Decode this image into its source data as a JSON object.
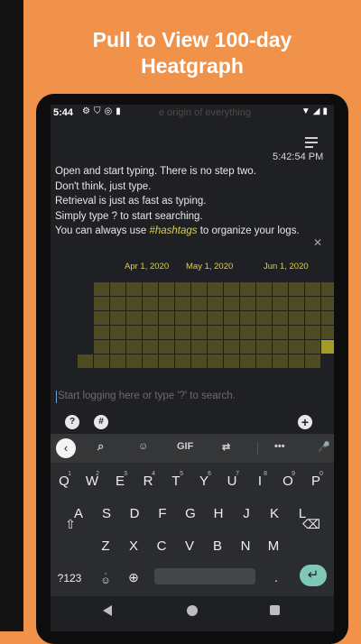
{
  "headline": {
    "line1": "Pull to View 100-day",
    "line2": "Heatgraph"
  },
  "status_bar": {
    "time": "5:44",
    "ghost_text": "e origin of everything"
  },
  "log": {
    "timestamp": "5:42:54 PM",
    "lines": [
      "Open and start typing. There is no step two.",
      "Don't think, just type.",
      "Retrieval is just as fast as typing.",
      "Simply type ? to start searching."
    ],
    "hashtag_prefix": "You can always use ",
    "hashtag_word": "#hashtags",
    "hashtag_suffix": " to organize your logs."
  },
  "heatgraph": {
    "dates": [
      "Apr 1, 2020",
      "May 1, 2020",
      "Jun 1, 2020"
    ],
    "days": 100,
    "highlighted_cells": 1,
    "colors": {
      "empty": "#4f4b23",
      "highlight": "#a39a28",
      "accent": "#e0cf45"
    }
  },
  "input": {
    "placeholder": "Start logging here or type '?' to search.",
    "help_label": "?",
    "hashtag_label": "#",
    "add_label": "+"
  },
  "keyboard": {
    "toolbar": {
      "gif_label": "GIF"
    },
    "row1": [
      {
        "k": "Q",
        "n": "1"
      },
      {
        "k": "W",
        "n": "2"
      },
      {
        "k": "E",
        "n": "3"
      },
      {
        "k": "R",
        "n": "4"
      },
      {
        "k": "T",
        "n": "5"
      },
      {
        "k": "Y",
        "n": "6"
      },
      {
        "k": "U",
        "n": "7"
      },
      {
        "k": "I",
        "n": "8"
      },
      {
        "k": "O",
        "n": "9"
      },
      {
        "k": "P",
        "n": "0"
      }
    ],
    "row2": [
      "A",
      "S",
      "D",
      "F",
      "G",
      "H",
      "J",
      "K",
      "L"
    ],
    "row3": [
      "Z",
      "X",
      "C",
      "V",
      "B",
      "N",
      "M"
    ],
    "symbols_label": "?123",
    "comma_label": ",",
    "period_label": "."
  },
  "icons": [
    "settings-icon",
    "shield-icon",
    "sync-icon",
    "sd-card-icon",
    "wifi-icon",
    "signal-icon",
    "battery-icon",
    "menu-icon",
    "close-icon",
    "chevron-left-icon",
    "search-icon",
    "sticker-icon",
    "translate-icon",
    "more-icon",
    "mic-icon",
    "shift-icon",
    "backspace-icon",
    "emoji-icon",
    "globe-icon",
    "enter-icon",
    "back-icon",
    "home-icon",
    "recents-icon"
  ]
}
